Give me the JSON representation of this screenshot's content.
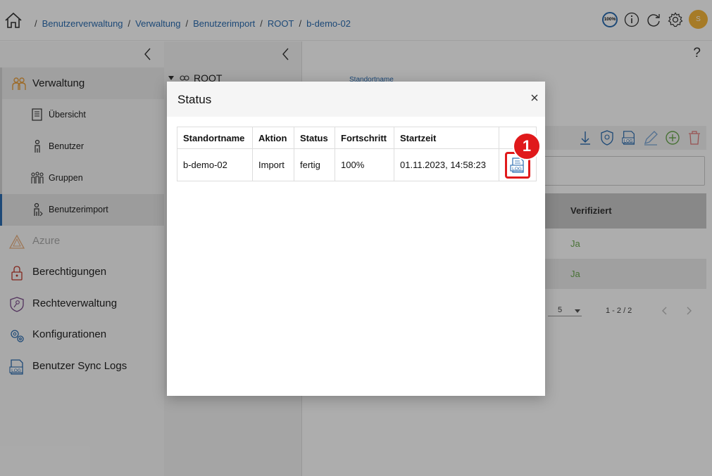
{
  "breadcrumb": [
    "Benutzerverwaltung",
    "Verwaltung",
    "Benutzerimport",
    "ROOT",
    "b-demo-02"
  ],
  "header": {
    "percent_label": "100%",
    "avatar_initial": "S"
  },
  "sidebar": {
    "main_item": "Verwaltung",
    "sub_items": [
      "Übersicht",
      "Benutzer",
      "Gruppen",
      "Benutzerimport"
    ],
    "other_items": [
      "Azure",
      "Berechtigungen",
      "Rechteverwaltung",
      "Konfigurationen",
      "Benutzer Sync Logs"
    ]
  },
  "tree": {
    "root": "ROOT"
  },
  "content": {
    "help": "?",
    "standortname_label": "Standortname",
    "column_verifiziert": "Verifiziert",
    "rows": [
      "Ja",
      "Ja"
    ],
    "page_size": "5",
    "range": "1 - 2 / 2"
  },
  "modal": {
    "title": "Status",
    "columns": [
      "Standortname",
      "Aktion",
      "Status",
      "Fortschritt",
      "Startzeit"
    ],
    "row": {
      "standortname": "b-demo-02",
      "aktion": "Import",
      "status": "fertig",
      "fortschritt": "100%",
      "startzeit": "01.11.2023, 14:58:23"
    },
    "badge": "1"
  },
  "colors": {
    "accent": "#2b6cb0",
    "highlight": "#e0191b",
    "avatar": "#f5b53a",
    "success": "#6aa84f"
  }
}
